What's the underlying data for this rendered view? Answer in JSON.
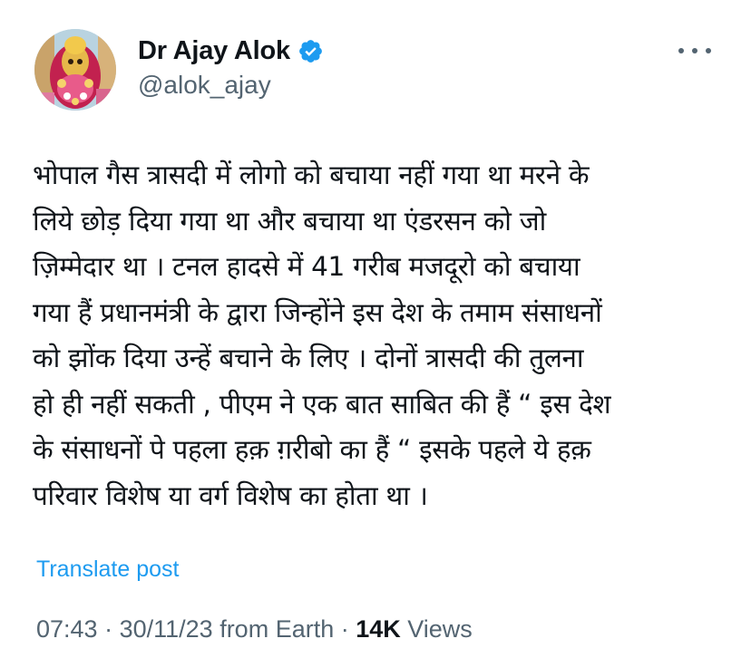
{
  "author": {
    "display_name": "Dr Ajay Alok",
    "handle": "@alok_ajay",
    "verified_icon": "verified-badge-icon",
    "avatar_icon": "profile-avatar"
  },
  "more_icon": "more-options-icon",
  "post": {
    "text": "भोपाल गैस त्रासदी में लोगो को बचाया नहीं गया था मरने के\nलिये छोड़ दिया गया था और बचाया था एंडरसन को जो\nज़िम्मेदार था । टनल हादसे में 41 गरीब मजदूरो को बचाया\nगया हैं प्रधानमंत्री के द्वारा जिन्होंने इस देश के तमाम संसाधनों\nको झोंक दिया उन्हें बचाने के लिए । दोनों त्रासदी की तुलना\nहो ही नहीं सकती , पीएम ने एक बात साबित की हैं “ इस देश\nके संसाधनों पे पहला हक़ ग़रीबो का हैं “ इसके पहले ये हक़\nपरिवार विशेष या वर्ग विशेष का होता था ।"
  },
  "translate_label": "Translate post",
  "meta": {
    "time": "07:43",
    "sep1": " · ",
    "date": "30/11/23",
    "source": " from Earth",
    "sep2": " · ",
    "views_count": "14K",
    "views_label": " Views"
  },
  "colors": {
    "accent": "#1d9bf0",
    "secondary_text": "#536471",
    "primary_text": "#0f1419"
  }
}
